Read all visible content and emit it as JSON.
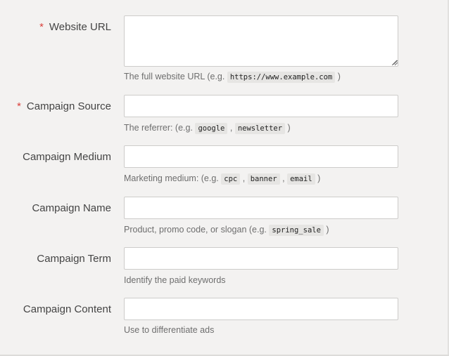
{
  "form": {
    "website_url": {
      "label": "Website URL",
      "required_mark": "*",
      "value": "",
      "help_prefix": "The full website URL (e.g.",
      "help_examples": [
        "https://www.example.com"
      ],
      "help_suffix": ")"
    },
    "campaign_source": {
      "label": "Campaign Source",
      "required_mark": "*",
      "value": "",
      "help_prefix": "The referrer: (e.g.",
      "help_examples": [
        "google",
        "newsletter"
      ],
      "separator": ",",
      "help_suffix": ")"
    },
    "campaign_medium": {
      "label": "Campaign Medium",
      "value": "",
      "help_prefix": "Marketing medium: (e.g.",
      "help_examples": [
        "cpc",
        "banner",
        "email"
      ],
      "separator": ",",
      "help_suffix": ")"
    },
    "campaign_name": {
      "label": "Campaign Name",
      "value": "",
      "help_prefix": "Product, promo code, or slogan (e.g.",
      "help_examples": [
        "spring_sale"
      ],
      "help_suffix": ")"
    },
    "campaign_term": {
      "label": "Campaign Term",
      "value": "",
      "help_text": "Identify the paid keywords"
    },
    "campaign_content": {
      "label": "Campaign Content",
      "value": "",
      "help_text": "Use to differentiate ads"
    }
  }
}
